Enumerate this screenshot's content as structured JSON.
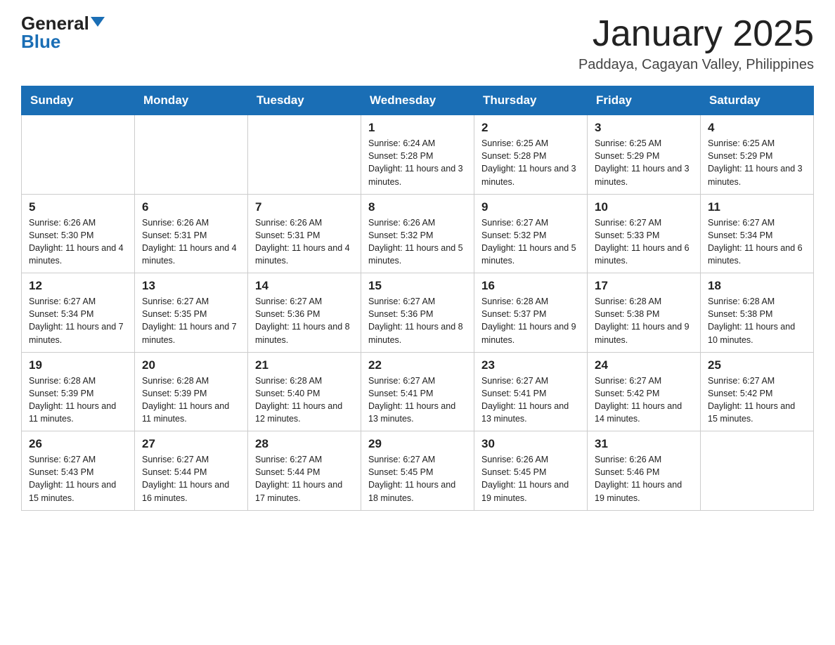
{
  "header": {
    "logo_general": "General",
    "logo_blue": "Blue",
    "month_title": "January 2025",
    "location": "Paddaya, Cagayan Valley, Philippines"
  },
  "weekdays": [
    "Sunday",
    "Monday",
    "Tuesday",
    "Wednesday",
    "Thursday",
    "Friday",
    "Saturday"
  ],
  "weeks": [
    [
      {
        "day": "",
        "info": ""
      },
      {
        "day": "",
        "info": ""
      },
      {
        "day": "",
        "info": ""
      },
      {
        "day": "1",
        "info": "Sunrise: 6:24 AM\nSunset: 5:28 PM\nDaylight: 11 hours and 3 minutes."
      },
      {
        "day": "2",
        "info": "Sunrise: 6:25 AM\nSunset: 5:28 PM\nDaylight: 11 hours and 3 minutes."
      },
      {
        "day": "3",
        "info": "Sunrise: 6:25 AM\nSunset: 5:29 PM\nDaylight: 11 hours and 3 minutes."
      },
      {
        "day": "4",
        "info": "Sunrise: 6:25 AM\nSunset: 5:29 PM\nDaylight: 11 hours and 3 minutes."
      }
    ],
    [
      {
        "day": "5",
        "info": "Sunrise: 6:26 AM\nSunset: 5:30 PM\nDaylight: 11 hours and 4 minutes."
      },
      {
        "day": "6",
        "info": "Sunrise: 6:26 AM\nSunset: 5:31 PM\nDaylight: 11 hours and 4 minutes."
      },
      {
        "day": "7",
        "info": "Sunrise: 6:26 AM\nSunset: 5:31 PM\nDaylight: 11 hours and 4 minutes."
      },
      {
        "day": "8",
        "info": "Sunrise: 6:26 AM\nSunset: 5:32 PM\nDaylight: 11 hours and 5 minutes."
      },
      {
        "day": "9",
        "info": "Sunrise: 6:27 AM\nSunset: 5:32 PM\nDaylight: 11 hours and 5 minutes."
      },
      {
        "day": "10",
        "info": "Sunrise: 6:27 AM\nSunset: 5:33 PM\nDaylight: 11 hours and 6 minutes."
      },
      {
        "day": "11",
        "info": "Sunrise: 6:27 AM\nSunset: 5:34 PM\nDaylight: 11 hours and 6 minutes."
      }
    ],
    [
      {
        "day": "12",
        "info": "Sunrise: 6:27 AM\nSunset: 5:34 PM\nDaylight: 11 hours and 7 minutes."
      },
      {
        "day": "13",
        "info": "Sunrise: 6:27 AM\nSunset: 5:35 PM\nDaylight: 11 hours and 7 minutes."
      },
      {
        "day": "14",
        "info": "Sunrise: 6:27 AM\nSunset: 5:36 PM\nDaylight: 11 hours and 8 minutes."
      },
      {
        "day": "15",
        "info": "Sunrise: 6:27 AM\nSunset: 5:36 PM\nDaylight: 11 hours and 8 minutes."
      },
      {
        "day": "16",
        "info": "Sunrise: 6:28 AM\nSunset: 5:37 PM\nDaylight: 11 hours and 9 minutes."
      },
      {
        "day": "17",
        "info": "Sunrise: 6:28 AM\nSunset: 5:38 PM\nDaylight: 11 hours and 9 minutes."
      },
      {
        "day": "18",
        "info": "Sunrise: 6:28 AM\nSunset: 5:38 PM\nDaylight: 11 hours and 10 minutes."
      }
    ],
    [
      {
        "day": "19",
        "info": "Sunrise: 6:28 AM\nSunset: 5:39 PM\nDaylight: 11 hours and 11 minutes."
      },
      {
        "day": "20",
        "info": "Sunrise: 6:28 AM\nSunset: 5:39 PM\nDaylight: 11 hours and 11 minutes."
      },
      {
        "day": "21",
        "info": "Sunrise: 6:28 AM\nSunset: 5:40 PM\nDaylight: 11 hours and 12 minutes."
      },
      {
        "day": "22",
        "info": "Sunrise: 6:27 AM\nSunset: 5:41 PM\nDaylight: 11 hours and 13 minutes."
      },
      {
        "day": "23",
        "info": "Sunrise: 6:27 AM\nSunset: 5:41 PM\nDaylight: 11 hours and 13 minutes."
      },
      {
        "day": "24",
        "info": "Sunrise: 6:27 AM\nSunset: 5:42 PM\nDaylight: 11 hours and 14 minutes."
      },
      {
        "day": "25",
        "info": "Sunrise: 6:27 AM\nSunset: 5:42 PM\nDaylight: 11 hours and 15 minutes."
      }
    ],
    [
      {
        "day": "26",
        "info": "Sunrise: 6:27 AM\nSunset: 5:43 PM\nDaylight: 11 hours and 15 minutes."
      },
      {
        "day": "27",
        "info": "Sunrise: 6:27 AM\nSunset: 5:44 PM\nDaylight: 11 hours and 16 minutes."
      },
      {
        "day": "28",
        "info": "Sunrise: 6:27 AM\nSunset: 5:44 PM\nDaylight: 11 hours and 17 minutes."
      },
      {
        "day": "29",
        "info": "Sunrise: 6:27 AM\nSunset: 5:45 PM\nDaylight: 11 hours and 18 minutes."
      },
      {
        "day": "30",
        "info": "Sunrise: 6:26 AM\nSunset: 5:45 PM\nDaylight: 11 hours and 19 minutes."
      },
      {
        "day": "31",
        "info": "Sunrise: 6:26 AM\nSunset: 5:46 PM\nDaylight: 11 hours and 19 minutes."
      },
      {
        "day": "",
        "info": ""
      }
    ]
  ]
}
